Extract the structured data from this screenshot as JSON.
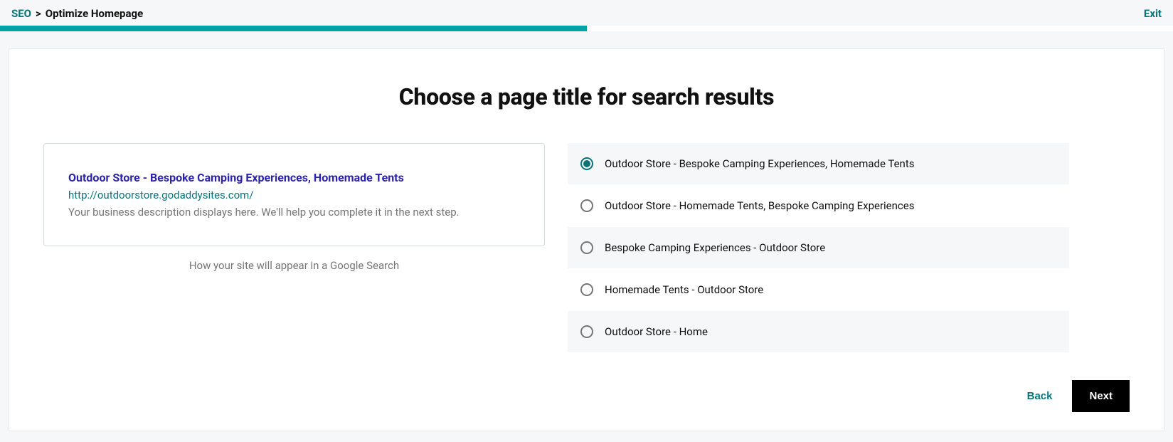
{
  "header": {
    "breadcrumb_root": "SEO",
    "breadcrumb_sep": ">",
    "breadcrumb_current": "Optimize Homepage",
    "exit_label": "Exit"
  },
  "progress": {
    "percent": 50
  },
  "page": {
    "title": "Choose a page title for search results"
  },
  "preview": {
    "title": "Outdoor Store - Bespoke Camping Experiences, Homemade Tents",
    "url": "http://outdoorstore.godaddysites.com/",
    "description": "Your business description displays here. We'll help you complete it in the next step.",
    "caption": "How your site will appear in a Google Search"
  },
  "options": [
    {
      "label": "Outdoor Store - Bespoke Camping Experiences, Homemade Tents",
      "selected": true
    },
    {
      "label": "Outdoor Store - Homemade Tents, Bespoke Camping Experiences",
      "selected": false
    },
    {
      "label": "Bespoke Camping Experiences - Outdoor Store",
      "selected": false
    },
    {
      "label": "Homemade Tents - Outdoor Store",
      "selected": false
    },
    {
      "label": "Outdoor Store - Home",
      "selected": false
    }
  ],
  "footer": {
    "back_label": "Back",
    "next_label": "Next"
  }
}
